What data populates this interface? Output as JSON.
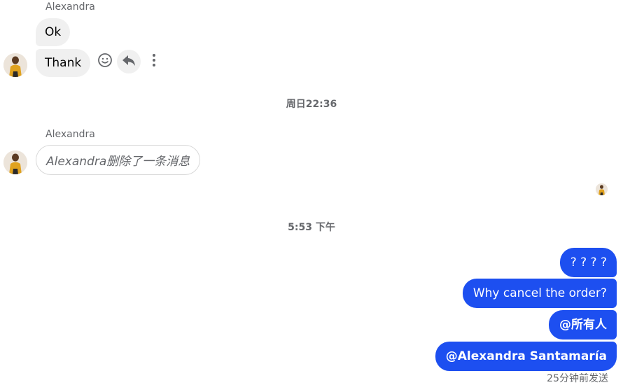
{
  "messages": {
    "group1": {
      "sender": "Alexandra",
      "bubble1": "Ok",
      "bubble2": "Thank"
    },
    "divider1": "周日22:36",
    "group2": {
      "sender": "Alexandra",
      "deleted_text": "Alexandra删除了一条消息"
    },
    "divider2": "5:53 下午",
    "outgoing": [
      "? ? ? ?",
      "Why cancel the order?",
      "@所有人",
      "@Alexandra Santamaría"
    ],
    "status": "25分钟前发送"
  },
  "icons": {
    "react": "smiley-icon",
    "reply": "reply-arrow-icon",
    "more": "more-vertical-icon"
  },
  "colors": {
    "outgoing_bubble": "#1d4ff0",
    "incoming_bubble": "#f0f0f0",
    "muted_text": "#65676b"
  }
}
